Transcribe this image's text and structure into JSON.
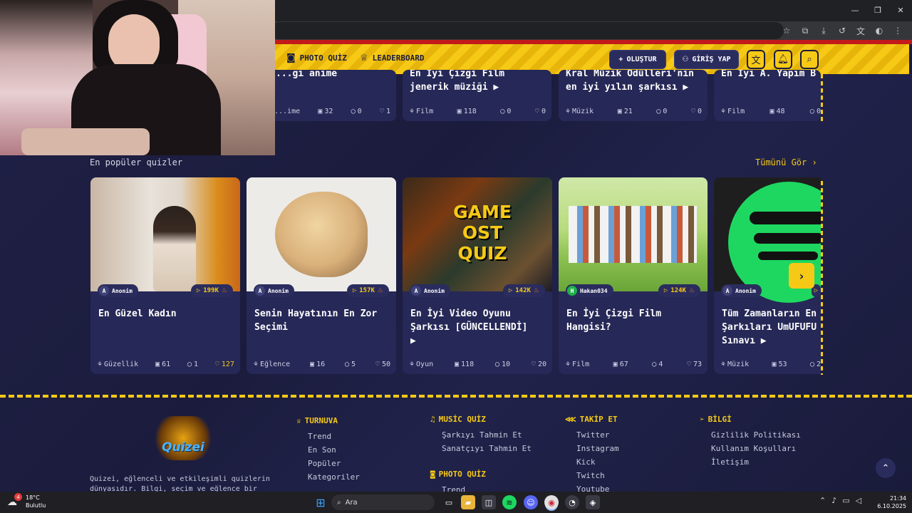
{
  "nav": {
    "photo_quiz": "PHOTO QUİZ",
    "leaderboard": "LEADERBOARD",
    "create": "OLUŞTUR",
    "login": "GİRİŞ YAP"
  },
  "top_cards": [
    {
      "title_line": "...ği anime",
      "category": "...ime",
      "questions": "32",
      "comments": "0",
      "likes": "1"
    },
    {
      "title_line1": "En İyi Çizgi Film",
      "title_line2": "jenerik müziği",
      "category": "Film",
      "questions": "118",
      "comments": "0",
      "likes": "0"
    },
    {
      "title_line1": "Kral Müzik Ödülleri'nin",
      "title_line2": "en iyi yılın şarkısı",
      "category": "Müzik",
      "questions": "21",
      "comments": "0",
      "likes": "0"
    },
    {
      "title_line1": "En İyi A. Yapım B",
      "title_line2": "",
      "category": "Film",
      "questions": "48",
      "comments": "0",
      "likes": ""
    }
  ],
  "popular": {
    "title": "En popüler quizler",
    "see_all": "Tümünü Gör",
    "cards": [
      {
        "author": "Anonim",
        "initial": "A",
        "plays": "199K",
        "title": "En Güzel Kadın",
        "category": "Güzellik",
        "questions": "61",
        "comments": "1",
        "likes": "127",
        "likes_hot": true
      },
      {
        "author": "Anonim",
        "initial": "A",
        "plays": "157K",
        "title": "Senin Hayatının En Zor Seçimi",
        "category": "Eğlence",
        "questions": "16",
        "comments": "5",
        "likes": "50",
        "likes_hot": false
      },
      {
        "author": "Anonim",
        "initial": "A",
        "plays": "142K",
        "title": "En İyi Video Oyunu Şarkısı [GÜNCELLENDİ]",
        "category": "Oyun",
        "questions": "118",
        "comments": "10",
        "likes": "20",
        "likes_hot": false
      },
      {
        "author": "Hakan034",
        "initial": "H",
        "plays": "124K",
        "title": "En İyi Çizgi Film Hangisi?",
        "category": "Film",
        "questions": "67",
        "comments": "4",
        "likes": "73",
        "likes_hot": false
      },
      {
        "author": "Anonim",
        "initial": "A",
        "plays": "",
        "title": "Tüm Zamanların En Şarkıları UmUFUFU Sınavı",
        "category": "Müzik",
        "questions": "53",
        "comments": "2",
        "likes": "",
        "likes_hot": false
      }
    ],
    "game_thumb_text": [
      "GAME",
      "OST",
      "QUIZ"
    ]
  },
  "footer": {
    "logo": "Quizei",
    "description_line1": "Quizei, eğlenceli ve etkileşimli quizlerin",
    "description_line2": "dünyasıdır. Bilgi, seçim ve eğlence bir arada!",
    "turnuva": {
      "title": "TURNUVA",
      "items": [
        "Trend",
        "En Son",
        "Popüler",
        "Kategoriler"
      ]
    },
    "music_quiz": {
      "title": "MUSİC QUİZ",
      "items": [
        "Şarkıyı Tahmin Et",
        "Sanatçıyı Tahmin Et"
      ]
    },
    "photo_quiz": {
      "title": "PHOTO QUİZ",
      "items": [
        "Trend"
      ]
    },
    "takip": {
      "title": "TAKİP ET",
      "items": [
        "Twitter",
        "Instagram",
        "Kick",
        "Twitch",
        "Youtube"
      ]
    },
    "bilgi": {
      "title": "BİLGİ",
      "items": [
        "Gizlilik Politikası",
        "Kullanım Koşulları",
        "İletişim"
      ]
    }
  },
  "taskbar": {
    "weather_temp": "18°C",
    "weather_desc": "Bulutlu",
    "weather_badge": "4",
    "search_placeholder": "Ara",
    "time": "21:34",
    "date": "6.10.2025"
  },
  "colors": {
    "accent": "#f6c916",
    "background": "#1b1c3d",
    "card": "#262857",
    "hot": "#f07a1a"
  }
}
